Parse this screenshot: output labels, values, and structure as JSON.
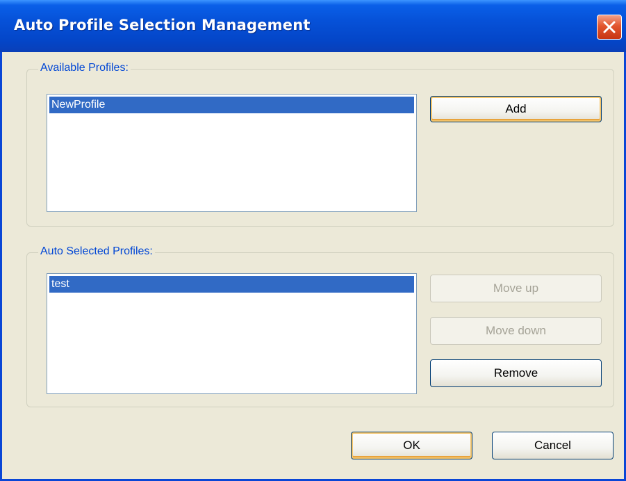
{
  "window": {
    "title": "Auto Profile Selection Management"
  },
  "available_profiles": {
    "legend": "Available Profiles:",
    "items": [
      "NewProfile"
    ],
    "add_label": "Add"
  },
  "auto_selected_profiles": {
    "legend": "Auto Selected Profiles:",
    "items": [
      "test"
    ],
    "move_up_label": "Move up",
    "move_down_label": "Move down",
    "remove_label": "Remove"
  },
  "footer": {
    "ok_label": "OK",
    "cancel_label": "Cancel"
  },
  "colors": {
    "titlebar": "#0651d8",
    "selection": "#316ac5",
    "legend_text": "#0046d5",
    "dialog_bg": "#ece9d8"
  },
  "icons": {
    "close": "close-x-icon"
  }
}
